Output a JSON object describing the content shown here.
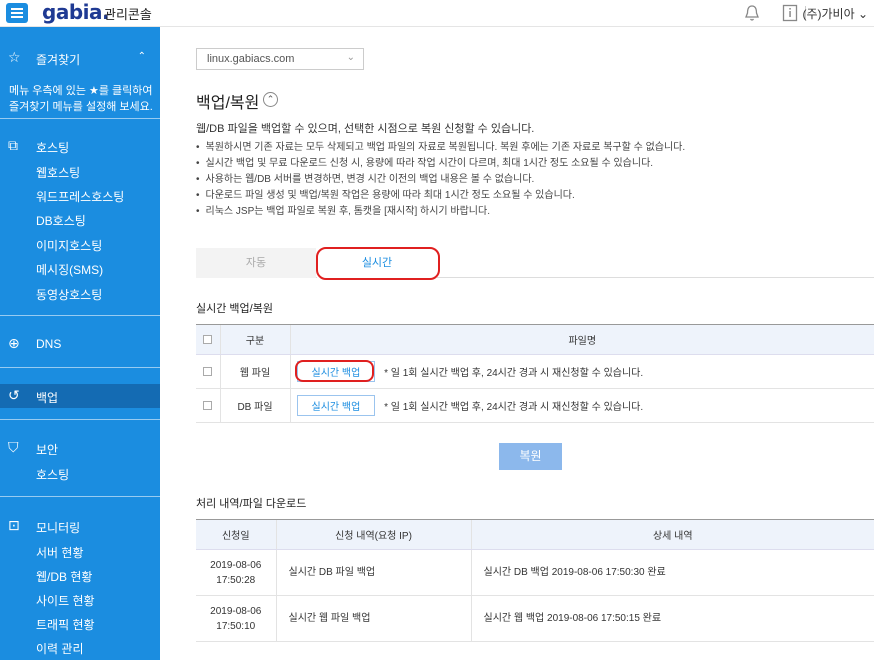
{
  "header": {
    "logo": "gabia.",
    "app_title": "관리콘솔",
    "user": "(주)가비아"
  },
  "sidebar": {
    "favorites_label": "즐겨찾기",
    "favorites_note": "메뉴 우측에 있는 ★를 클릭하여 즐겨찾기 메뉴를 설정해 보세요.",
    "hosting_label": "호스팅",
    "hosting_items": [
      "웹호스팅",
      "워드프레스호스팅",
      "DB호스팅",
      "이미지호스팅",
      "메시징(SMS)",
      "동영상호스팅"
    ],
    "dns_label": "DNS",
    "backup_label": "백업",
    "security_label": "보안",
    "security_items": [
      "호스팅"
    ],
    "monitoring_label": "모니터링",
    "monitoring_items": [
      "서버 현황",
      "웹/DB 현황",
      "사이트 현황",
      "트래픽 현황",
      "이력 관리"
    ]
  },
  "main": {
    "domain_value": "linux.gabiacs.com",
    "page_title": "백업/복원",
    "intro": "웹/DB 파일을 백업할 수 있으며, 선택한 시점으로 복원 신청할 수 있습니다.",
    "bullets": [
      "복원하시면 기존 자료는 모두 삭제되고 백업 파일의 자료로 복원됩니다. 복원 후에는 기존 자료로 복구할 수 없습니다.",
      "실시간 백업 및 무료 다운로드 신청 시, 용량에 따라 작업 시간이 다르며, 최대 1시간 정도 소요될 수 있습니다.",
      "사용하는 웹/DB 서버를 변경하면, 변경 시간 이전의 백업 내용은 볼 수 없습니다.",
      "다운로드 파일 생성 및 백업/복원 작업은 용량에 따라 최대 1시간 정도 소요될 수 있습니다.",
      "리눅스 JSP는 백업 파일로 복원 후, 톰캣을 [재시작] 하시기 바랍니다."
    ],
    "tabs": {
      "auto": "자동",
      "realtime": "실시간"
    },
    "rt_section_title": "실시간 백업/복원",
    "rt_table": {
      "col_type": "구분",
      "col_file": "파일명",
      "rows": [
        {
          "type": "웹 파일",
          "button": "실시간 백업",
          "note": "* 일 1회 실시간 백업 후, 24시간 경과 시 재신청할 수 있습니다."
        },
        {
          "type": "DB 파일",
          "button": "실시간 백업",
          "note": "* 일 1회 실시간 백업 후, 24시간 경과 시 재신청할 수 있습니다."
        }
      ]
    },
    "restore_button": "복원",
    "history_title": "처리 내역/파일 다운로드",
    "history_table": {
      "col_date": "신청일",
      "col_request": "신청 내역(요청 IP)",
      "col_detail": "상세 내역",
      "rows": [
        {
          "date": "2019-08-06",
          "time": "17:50:28",
          "request": "실시간 DB 파일 백업",
          "detail": "실시간 DB 백업 2019-08-06 17:50:30 완료"
        },
        {
          "date": "2019-08-06",
          "time": "17:50:10",
          "request": "실시간 웹 파일 백업",
          "detail": "실시간 웹 백업 2019-08-06 17:50:15 완료"
        }
      ]
    }
  },
  "colors": {
    "brand_blue": "#1b8de0",
    "active_blue": "#146bb3",
    "highlight_red": "#e02020"
  }
}
